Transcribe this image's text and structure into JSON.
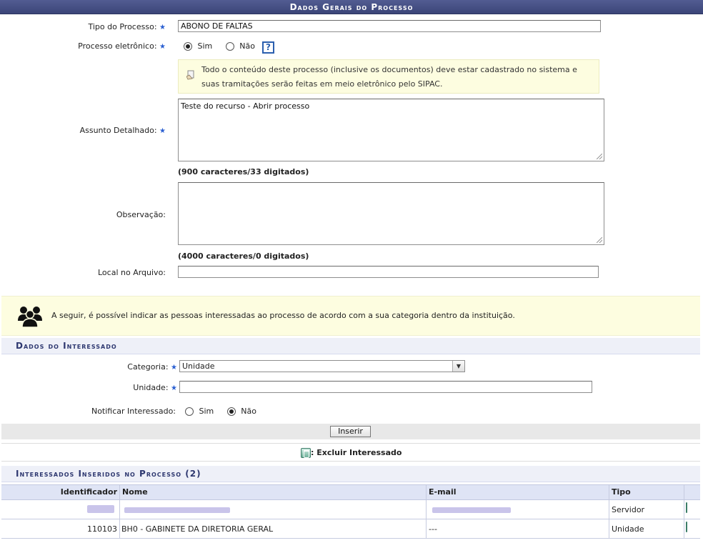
{
  "caption": "Dados Gerais do Processo",
  "form": {
    "tipo_label": "Tipo do Processo:",
    "tipo_value": "ABONO DE FALTAS",
    "eletronico_label": "Processo eletrônico:",
    "eletronico_sim": "Sim",
    "eletronico_nao": "Não",
    "eletronico_selected": "Sim",
    "help_icon": "question-icon",
    "help_glyph": "?",
    "note": "Todo o conteúdo deste processo (inclusive os documentos) deve estar cadastrado no sistema e suas tramitações serão feitas em meio eletrônico pelo SIPAC.",
    "assunto_label": "Assunto Detalhado:",
    "assunto_value": "Teste do recurso - Abrir processo",
    "assunto_counter": "(900 caracteres/33 digitados)",
    "observacao_label": "Observação:",
    "observacao_value": "",
    "observacao_counter": "(4000 caracteres/0 digitados)",
    "local_label": "Local no Arquivo:",
    "local_value": "",
    "required_mark": "★"
  },
  "info": {
    "icon": "people-group-icon",
    "text": "A seguir, é possível indicar as pessoas interessadas ao processo de acordo com a sua categoria dentro da instituição."
  },
  "interessado": {
    "caption": "Dados do Interessado",
    "categoria_label": "Categoria:",
    "categoria_value": "Unidade",
    "unidade_label": "Unidade:",
    "unidade_value": "",
    "notificar_label": "Notificar Interessado:",
    "notificar_sim": "Sim",
    "notificar_nao": "Não",
    "notificar_selected": "Não",
    "insert_button": "Inserir"
  },
  "legend": {
    "icon": "trash-icon",
    "text": ": Excluir Interessado"
  },
  "inseridos": {
    "caption": "Interessados Inseridos no Processo (2)",
    "columns": [
      "Identificador",
      "Nome",
      "E-mail",
      "Tipo"
    ],
    "rows": [
      {
        "identificador": "",
        "nome": "",
        "email": "",
        "tipo": "Servidor",
        "redacted": true
      },
      {
        "identificador": "110103",
        "nome": "BH0 - GABINETE DA DIRETORIA GERAL",
        "email": "---",
        "tipo": "Unidade",
        "redacted": false
      }
    ]
  },
  "colors": {
    "caption_bg": "#3b4578",
    "accent": "#2e3870",
    "required_star": "#2a5fd1",
    "note_bg": "#fdfde0",
    "header_row_bg": "#dfe4f5"
  }
}
